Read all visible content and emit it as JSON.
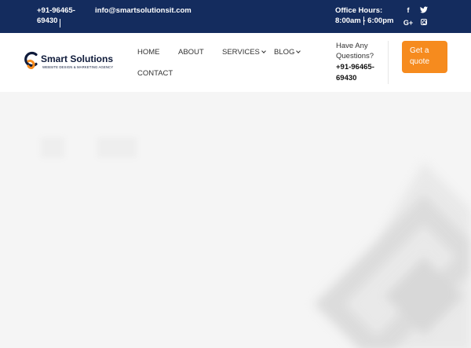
{
  "topbar": {
    "phone": "+91-96465-69430",
    "email": "info@smartsolutionsit.com",
    "office_hours": "Office Hours: 8:00am - 6:00pm"
  },
  "social": {
    "facebook_icon": "f",
    "twitter_icon": "🐦",
    "googleplus_icon": "G+"
  },
  "brand": {
    "name": "Smart Solutions",
    "tagline": "WEBSITE DESIGN & MARKETING AGENCY",
    "colors": {
      "navy": "#142c5e",
      "orange": "#f68b1e"
    }
  },
  "nav": {
    "home": "HOME",
    "about": "ABOUT",
    "services": "SERVICES",
    "blog": "BLOG",
    "contact": "CONTACT"
  },
  "contact_box": {
    "question": "Have Any Questions?",
    "phone": "+91-96465-69430"
  },
  "cta": {
    "label": "Get a quote"
  }
}
